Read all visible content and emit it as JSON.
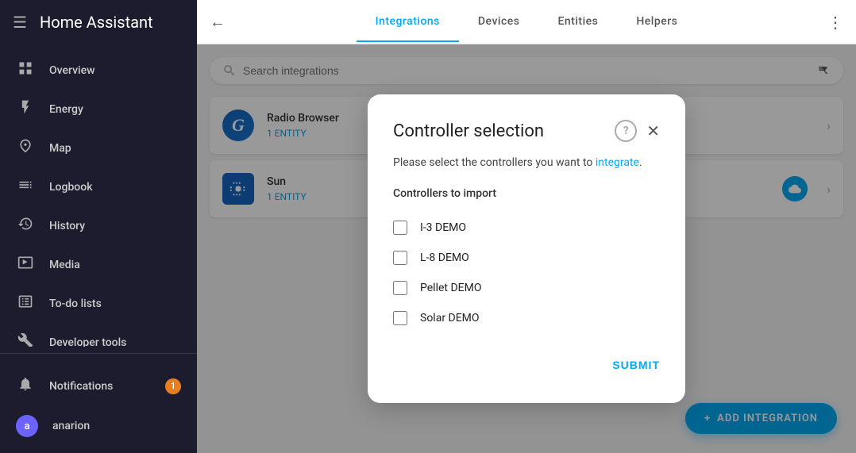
{
  "app": {
    "title": "Home Assistant"
  },
  "sidebar": {
    "items": [
      {
        "id": "overview",
        "label": "Overview",
        "icon": "⊞"
      },
      {
        "id": "energy",
        "label": "Energy",
        "icon": "⚡"
      },
      {
        "id": "map",
        "label": "Map",
        "icon": "👤"
      },
      {
        "id": "logbook",
        "label": "Logbook",
        "icon": "☰"
      },
      {
        "id": "history",
        "label": "History",
        "icon": "📊"
      },
      {
        "id": "media",
        "label": "Media",
        "icon": "▶"
      },
      {
        "id": "todo",
        "label": "To-do lists",
        "icon": "✔"
      },
      {
        "id": "devtools",
        "label": "Developer tools",
        "icon": "🔧"
      }
    ],
    "bottom_items": [
      {
        "id": "notifications",
        "label": "Notifications",
        "icon": "🔔",
        "badge": "1"
      },
      {
        "id": "user",
        "label": "anarion",
        "icon": "a"
      }
    ]
  },
  "header": {
    "tabs": [
      {
        "id": "integrations",
        "label": "Integrations",
        "active": true
      },
      {
        "id": "devices",
        "label": "Devices",
        "active": false
      },
      {
        "id": "entities",
        "label": "Entities",
        "active": false
      },
      {
        "id": "helpers",
        "label": "Helpers",
        "active": false
      }
    ],
    "more_icon": "⋮",
    "back_icon": "←"
  },
  "search": {
    "placeholder": "Search integrations"
  },
  "integrations": [
    {
      "id": "google-translate",
      "name": "Radio Browser",
      "meta": "1 ENTITY",
      "logo_text": "G"
    },
    {
      "id": "sun",
      "name": "Sun",
      "meta": "1 ENTITY",
      "logo_text": "☰"
    }
  ],
  "add_button": {
    "label": "ADD INTEGRATION",
    "icon": "+"
  },
  "dialog": {
    "title": "Controller selection",
    "description_prefix": "Please select the controllers you want to ",
    "description_link": "integrate",
    "description_suffix": ".",
    "section_label": "Controllers to import",
    "controllers": [
      {
        "id": "i3demo",
        "label": "I-3 DEMO",
        "checked": false
      },
      {
        "id": "l8demo",
        "label": "L-8 DEMO",
        "checked": false
      },
      {
        "id": "pelletdemo",
        "label": "Pellet DEMO",
        "checked": false
      },
      {
        "id": "solardemo",
        "label": "Solar DEMO",
        "checked": false
      }
    ],
    "submit_label": "SUBMIT",
    "help_icon": "?",
    "close_icon": "✕"
  }
}
